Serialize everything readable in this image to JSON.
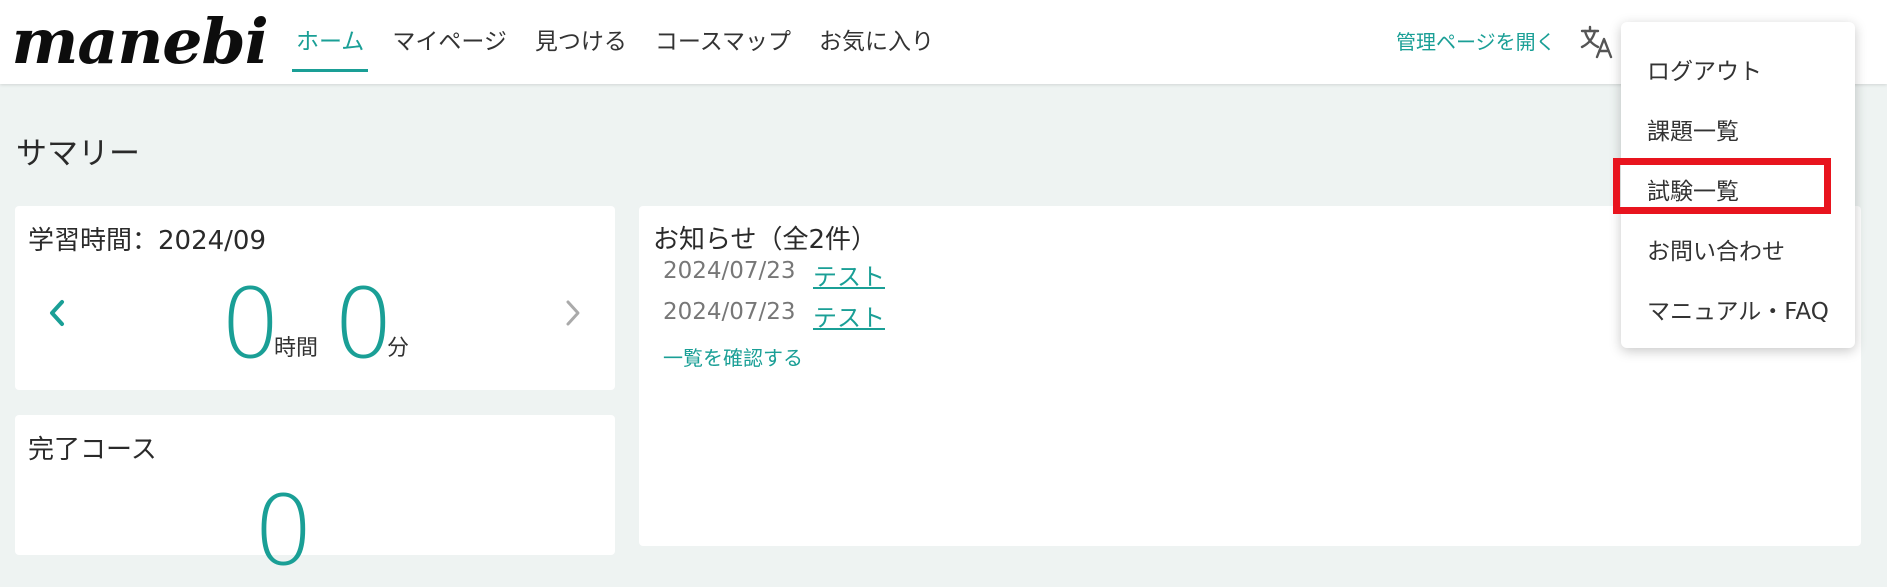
{
  "header": {
    "logo": "manebi",
    "nav": [
      {
        "label": "ホーム",
        "active": true
      },
      {
        "label": "マイページ",
        "active": false
      },
      {
        "label": "見つける",
        "active": false
      },
      {
        "label": "コースマップ",
        "active": false
      },
      {
        "label": "お気に入り",
        "active": false
      }
    ],
    "admin_link": "管理ページを開く",
    "translate_icon": "translate-icon"
  },
  "dropdown": {
    "items": [
      "ログアウト",
      "課題一覧",
      "試験一覧",
      "お問い合わせ",
      "マニュアル・FAQ"
    ],
    "highlighted_item": "試験一覧",
    "highlight_color": "#e8141e"
  },
  "main": {
    "title": "サマリー",
    "study_time": {
      "title": "学習時間：2024/09",
      "hours": "0",
      "hours_unit": "時間",
      "minutes": "0",
      "minutes_unit": "分",
      "prev_icon": "chevron-left-icon",
      "next_icon": "chevron-right-icon"
    },
    "completed": {
      "title": "完了コース",
      "count": "0"
    },
    "news": {
      "title": "お知らせ（全2件）",
      "items": [
        {
          "date": "2024/07/23",
          "label": "テスト"
        },
        {
          "date": "2024/07/23",
          "label": "テスト"
        }
      ],
      "view_all": "一覧を確認する"
    }
  },
  "colors": {
    "accent": "#1a9f96",
    "background": "#eef3f2"
  }
}
